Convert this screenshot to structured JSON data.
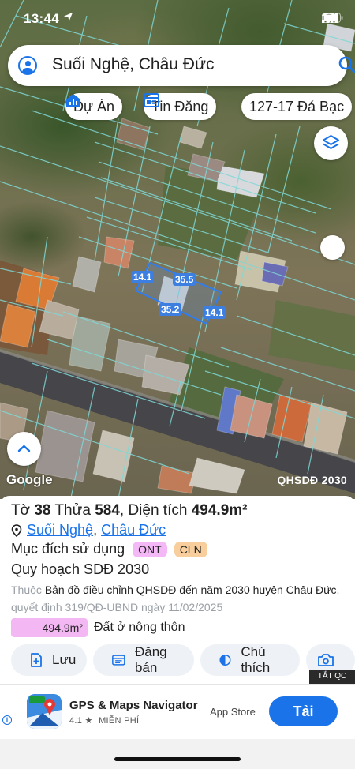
{
  "status_bar": {
    "time": "13:44"
  },
  "search": {
    "query": "Suối Nghệ, Châu Đức"
  },
  "chips": [
    {
      "label": "Dự Án",
      "icon": "house-chart-icon"
    },
    {
      "label": "Tin Đăng",
      "icon": "newspaper-icon"
    },
    {
      "label": "127-17 Đá Bạc"
    }
  ],
  "map": {
    "attribution": "Google",
    "overlay_label": "QHSDĐ 2030",
    "dimensions": [
      "14.1",
      "35.5",
      "35.2",
      "14.1"
    ]
  },
  "parcel": {
    "sheet_label": "Tờ",
    "sheet": "38",
    "plot_label": "Thửa",
    "plot": "584",
    "area_label": "Diện tích",
    "area": "494.9m²",
    "location_commune": "Suối Nghệ",
    "location_district": "Châu Đức",
    "location_sep": ",",
    "use_label": "Mục đích sử dụng",
    "use_codes": [
      {
        "code": "ONT",
        "color": "#f5b8f7"
      },
      {
        "code": "CLN",
        "color": "#f7ce9c"
      }
    ],
    "plan_title": "Quy hoạch SDĐ 2030",
    "plan_prefix": "Thuộc",
    "plan_doc": "Bản đồ điều chỉnh QHSDĐ đến năm 2030 huyện Châu Đức",
    "plan_decision": ", quyết định 319/QĐ-UBND ngày 11/02/2025",
    "area_breakdown": [
      {
        "value": "494.9m²",
        "label": "Đất ở nông thôn",
        "fraction": 1.0,
        "color": "#f3b8f4"
      }
    ]
  },
  "actions": [
    {
      "label": "Lưu",
      "icon": "save-icon"
    },
    {
      "label": "Đăng bán",
      "icon": "post-listing-icon"
    },
    {
      "label": "Chú thích",
      "icon": "legend-icon"
    }
  ],
  "ad": {
    "close_label": "TẮT QC",
    "info": "i",
    "title": "GPS & Maps Navigator",
    "rating": "4.1 ★",
    "price": "MIỄN PHÍ",
    "store": "App Store",
    "cta": "Tải"
  }
}
